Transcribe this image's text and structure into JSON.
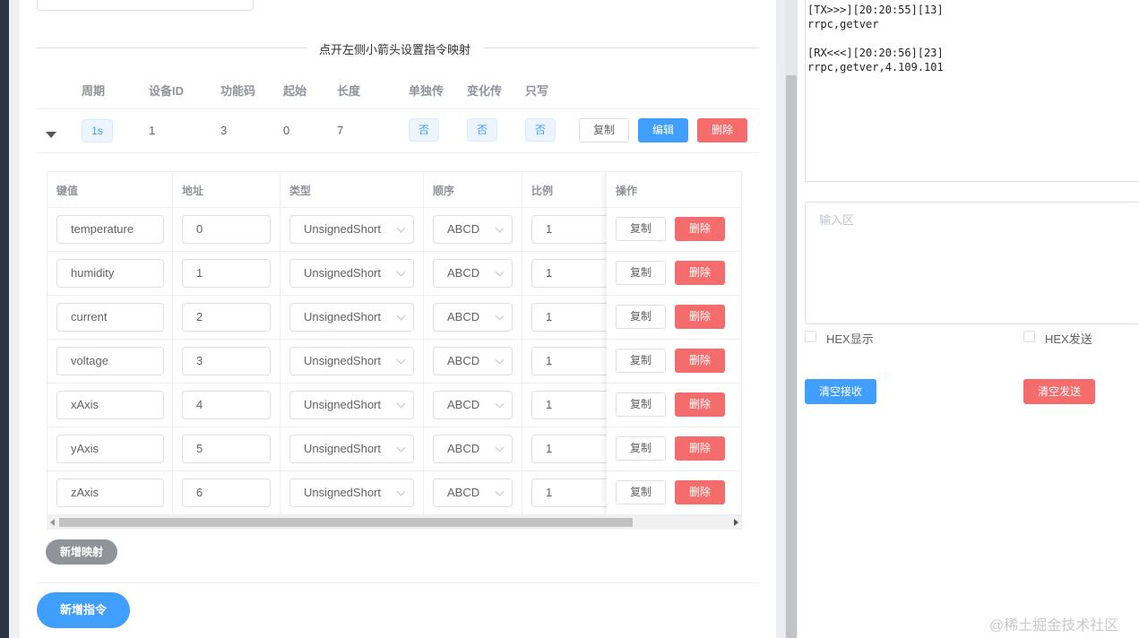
{
  "divider_text": "点开左侧小箭头设置指令映射",
  "command_table": {
    "headers": [
      "周期",
      "设备ID",
      "功能码",
      "起始",
      "长度",
      "单独传",
      "变化传",
      "只写"
    ],
    "row": {
      "period": "1s",
      "device_id": "1",
      "func_code": "3",
      "start": "0",
      "length": "7",
      "single": "否",
      "change": "否",
      "write_only": "否",
      "copy_label": "复制",
      "edit_label": "编辑",
      "delete_label": "删除"
    }
  },
  "mapping_table": {
    "headers": [
      "键值",
      "地址",
      "类型",
      "顺序",
      "比例",
      "操作"
    ],
    "rows": [
      {
        "key": "temperature",
        "address": "0",
        "type": "UnsignedShort",
        "order": "ABCD",
        "ratio": "1",
        "copy": "复制",
        "delete": "删除"
      },
      {
        "key": "humidity",
        "address": "1",
        "type": "UnsignedShort",
        "order": "ABCD",
        "ratio": "1",
        "copy": "复制",
        "delete": "删除"
      },
      {
        "key": "current",
        "address": "2",
        "type": "UnsignedShort",
        "order": "ABCD",
        "ratio": "1",
        "copy": "复制",
        "delete": "删除"
      },
      {
        "key": "voltage",
        "address": "3",
        "type": "UnsignedShort",
        "order": "ABCD",
        "ratio": "1",
        "copy": "复制",
        "delete": "删除"
      },
      {
        "key": "xAxis",
        "address": "4",
        "type": "UnsignedShort",
        "order": "ABCD",
        "ratio": "1",
        "copy": "复制",
        "delete": "删除"
      },
      {
        "key": "yAxis",
        "address": "5",
        "type": "UnsignedShort",
        "order": "ABCD",
        "ratio": "1",
        "copy": "复制",
        "delete": "删除"
      },
      {
        "key": "zAxis",
        "address": "6",
        "type": "UnsignedShort",
        "order": "ABCD",
        "ratio": "1",
        "copy": "复制",
        "delete": "删除"
      }
    ]
  },
  "add_mapping_label": "新增映射",
  "add_command_label": "新增指令",
  "terminal": {
    "lines": [
      "[TX>>>][20:20:55][13]",
      "rrpc,getver",
      "",
      "[RX<<<][20:20:56][23]",
      "rrpc,getver,4.109.101"
    ]
  },
  "input_area_placeholder": "输入区",
  "hex_display_label": "HEX显示",
  "hex_send_label": "HEX发送",
  "clear_receive_label": "清空接收",
  "clear_send_label": "清空发送",
  "watermark": "@稀土掘金技术社区",
  "colors": {
    "primary": "#409eff",
    "danger": "#f56c6c",
    "info": "#909399"
  }
}
